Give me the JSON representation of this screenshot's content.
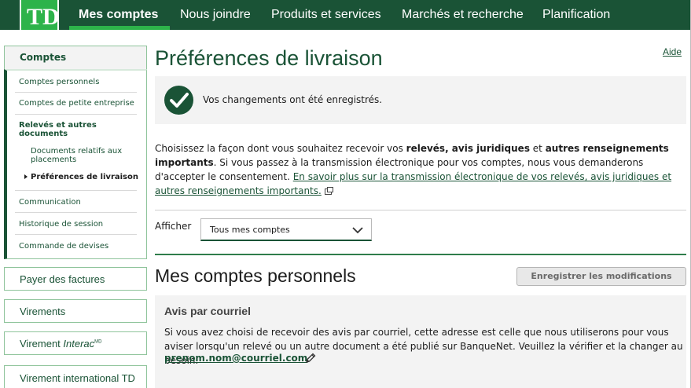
{
  "brand": {
    "logo_text": "TD",
    "logo_color": "#2db34a",
    "nav_color": "#1a5336"
  },
  "topnav": {
    "items": [
      "Mes comptes",
      "Nous joindre",
      "Produits et services",
      "Marchés et recherche",
      "Planification"
    ],
    "active": "Mes comptes"
  },
  "sidebar": {
    "heading": "Comptes",
    "links": {
      "personal": "Comptes personnels",
      "small_business": "Comptes de petite entreprise",
      "statements": "Relevés et autres documents",
      "investment_docs": "Documents relatifs aux placements",
      "delivery_prefs": "Préférences de livraison",
      "communication": "Communication",
      "session_history": "Historique de session",
      "currency_order": "Commande de devises"
    },
    "sections": {
      "pay_bills": "Payer des factures",
      "transfers": "Virements",
      "interac_prefix": "Virement ",
      "interac_brand": "Interac",
      "interac_sup": "MD",
      "international": "Virement international TD"
    }
  },
  "page": {
    "title": "Préférences de livraison",
    "help": "Aide",
    "success_message": "Vos changements ont été enregistrés.",
    "intro": {
      "p1": "Choisissez la façon dont vous souhaitez recevoir vos ",
      "b1": "relevés, avis juridiques",
      "p2": " et ",
      "b2": "autres renseignements importants",
      "p3": ". Si vous passez à la transmission électronique pour vos comptes, nous vous demanderons d'accepter le consentement. ",
      "link": "En savoir plus sur la transmission électronique de vos relevés, avis juridiques et autres renseignements importants."
    },
    "filter": {
      "label": "Afficher",
      "selected": "Tous mes comptes"
    },
    "section_title": "Mes comptes personnels",
    "save_button": "Enregistrer les modifications",
    "email": {
      "title": "Avis par courriel",
      "description": "Si vous avez choisi de recevoir des avis par courriel, cette adresse est celle que nous utiliserons pour vous aviser lorsqu'un relevé ou un autre document a été publié sur BanqueNet. Veuillez la vérifier et la changer au besoin.",
      "address": "prenom.nom@courriel.com"
    }
  }
}
